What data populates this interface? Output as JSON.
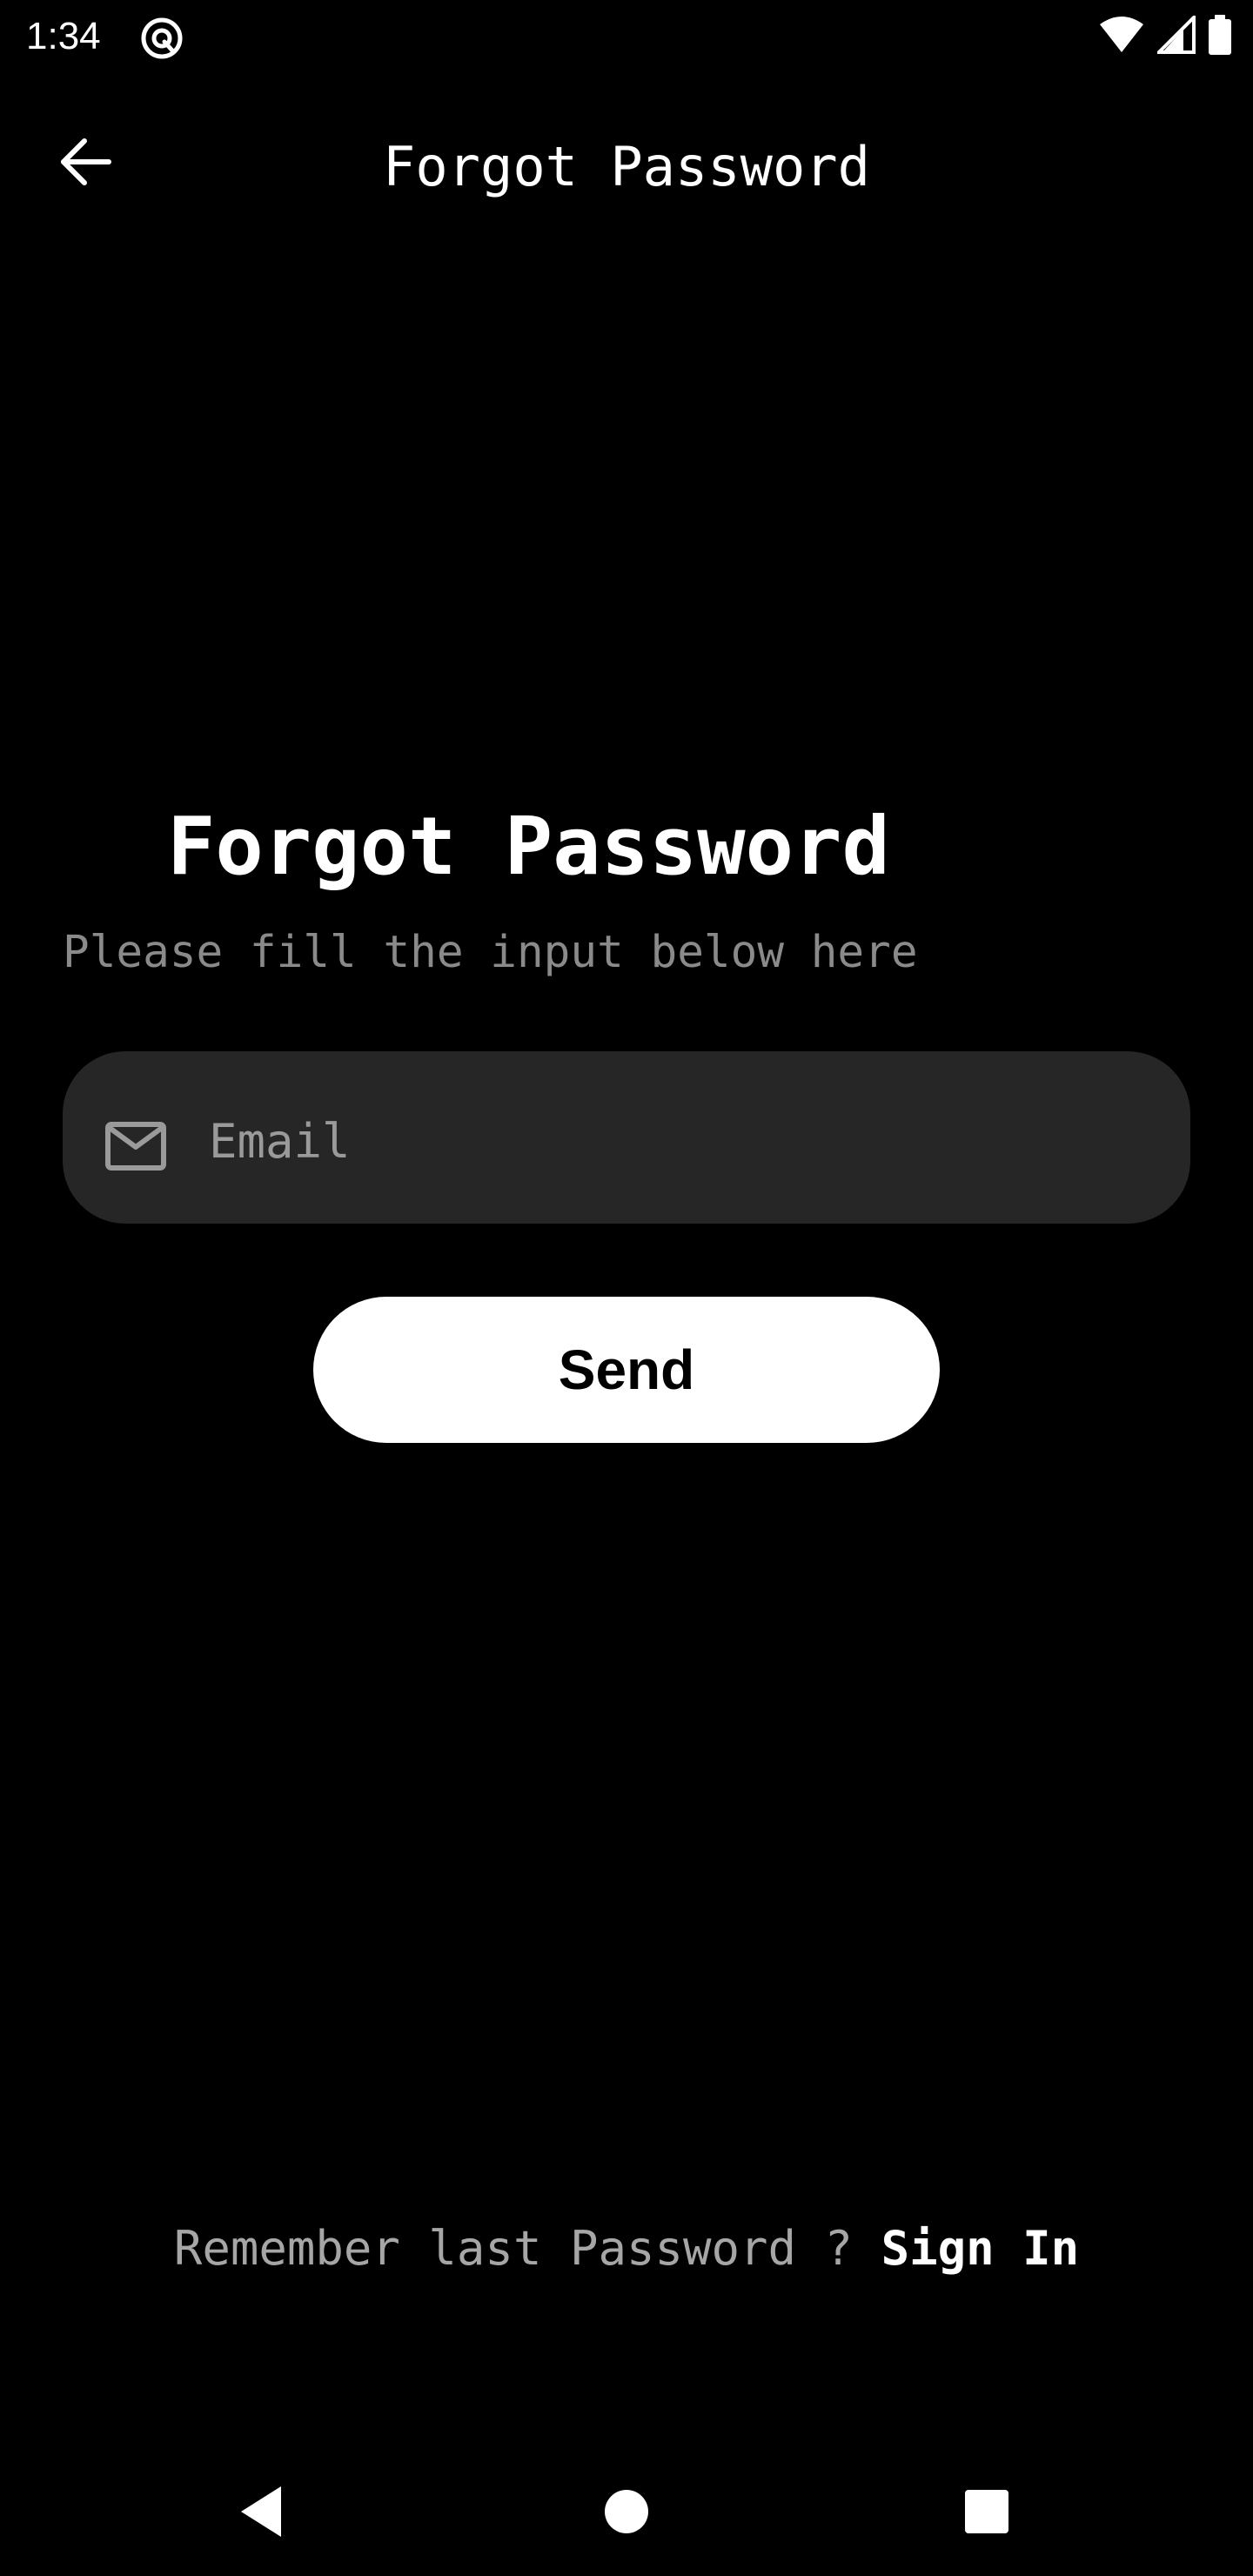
{
  "status_bar": {
    "time": "1:34",
    "icons": [
      "app-notification-icon",
      "wifi-icon",
      "cellular-signal-icon",
      "battery-icon"
    ]
  },
  "app_bar": {
    "back_icon": "arrow-left-icon",
    "title": "Forgot Password"
  },
  "main": {
    "heading": "Forgot Password",
    "subtitle": "Please fill the input below here",
    "email_field": {
      "icon": "mail-icon",
      "placeholder": "Email",
      "value": ""
    },
    "send_label": "Send"
  },
  "footer": {
    "prompt": "Remember last Password ? ",
    "sign_in_label": "Sign In"
  },
  "nav_bar": {
    "icons": [
      "back-triangle-icon",
      "home-circle-icon",
      "recents-square-icon"
    ]
  },
  "colors": {
    "background": "#000000",
    "field_background": "#262626",
    "muted_text": "#8a8a8a",
    "primary_text": "#ffffff",
    "button_background": "#ffffff",
    "button_text": "#000000"
  }
}
